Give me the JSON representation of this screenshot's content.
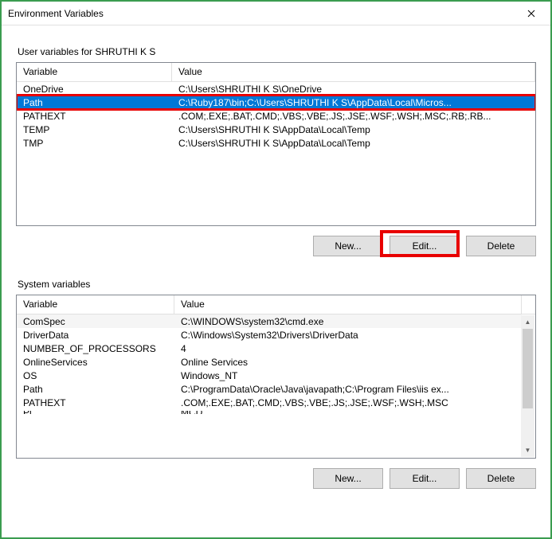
{
  "window": {
    "title": "Environment Variables"
  },
  "userSection": {
    "label": "User variables for SHRUTHI K S",
    "headers": {
      "variable": "Variable",
      "value": "Value"
    },
    "rows": [
      {
        "variable": "OneDrive",
        "value": "C:\\Users\\SHRUTHI K S\\OneDrive"
      },
      {
        "variable": "Path",
        "value": "C:\\Ruby187\\bin;C:\\Users\\SHRUTHI K S\\AppData\\Local\\Micros..."
      },
      {
        "variable": "PATHEXT",
        "value": ".COM;.EXE;.BAT;.CMD;.VBS;.VBE;.JS;.JSE;.WSF;.WSH;.MSC;.RB;.RB..."
      },
      {
        "variable": "TEMP",
        "value": "C:\\Users\\SHRUTHI K S\\AppData\\Local\\Temp"
      },
      {
        "variable": "TMP",
        "value": "C:\\Users\\SHRUTHI K S\\AppData\\Local\\Temp"
      }
    ],
    "buttons": {
      "new": "New...",
      "edit": "Edit...",
      "delete": "Delete"
    }
  },
  "systemSection": {
    "label": "System variables",
    "headers": {
      "variable": "Variable",
      "value": "Value"
    },
    "rows": [
      {
        "variable": "ComSpec",
        "value": "C:\\WINDOWS\\system32\\cmd.exe"
      },
      {
        "variable": "DriverData",
        "value": "C:\\Windows\\System32\\Drivers\\DriverData"
      },
      {
        "variable": "NUMBER_OF_PROCESSORS",
        "value": "4"
      },
      {
        "variable": "OnlineServices",
        "value": "Online Services"
      },
      {
        "variable": "OS",
        "value": "Windows_NT"
      },
      {
        "variable": "Path",
        "value": "C:\\ProgramData\\Oracle\\Java\\javapath;C:\\Program Files\\iis ex..."
      },
      {
        "variable": "PATHEXT",
        "value": ".COM;.EXE;.BAT;.CMD;.VBS;.VBE;.JS;.JSE;.WSF;.WSH;.MSC"
      }
    ],
    "partialRow": {
      "variable": "Platform",
      "value": "MCD"
    },
    "buttons": {
      "new": "New...",
      "edit": "Edit...",
      "delete": "Delete"
    }
  }
}
